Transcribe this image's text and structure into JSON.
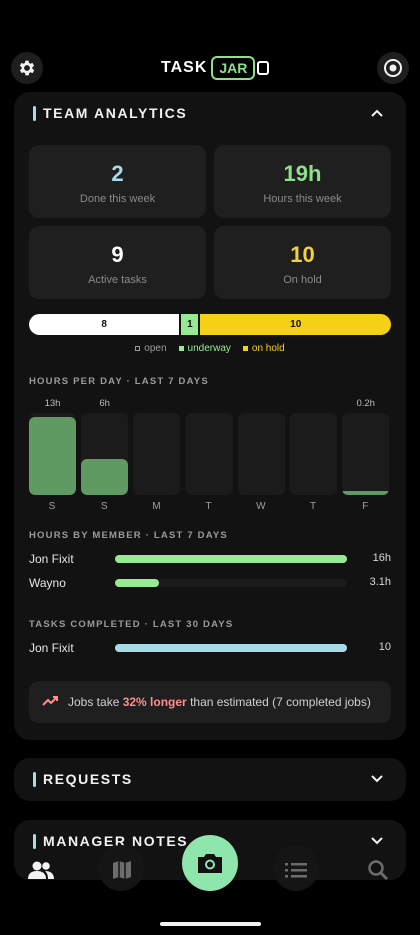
{
  "header": {
    "settings_icon": "gear-icon",
    "logo_left": "TASK",
    "logo_right": "JAR",
    "record_icon": "record-icon"
  },
  "analytics": {
    "title": "TEAM ANALYTICS",
    "stats": [
      {
        "value": "2",
        "label": "Done this week",
        "color": "#a8dbe6"
      },
      {
        "value": "19h",
        "label": "Hours this week",
        "color": "#8ee08a"
      },
      {
        "value": "9",
        "label": "Active tasks",
        "color": "#ffffff"
      },
      {
        "value": "10",
        "label": "On hold",
        "color": "#f4d03f"
      }
    ],
    "status_bar": [
      {
        "label": "8",
        "name": "open",
        "count": 8,
        "color": "#ffffff"
      },
      {
        "label": "1",
        "name": "underway",
        "count": 1,
        "color": "#97ea94"
      },
      {
        "label": "10",
        "name": "on hold",
        "count": 10,
        "color": "#f4d017"
      }
    ],
    "hours_per_day": {
      "label": "HOURS PER DAY · LAST 7 DAYS",
      "days": [
        "S",
        "S",
        "M",
        "T",
        "W",
        "T",
        "F"
      ],
      "value_labels": [
        "13h",
        "6h",
        "",
        "",
        "",
        "",
        "0.2h"
      ],
      "values": [
        13,
        6,
        0,
        0,
        0,
        0,
        0.2
      ],
      "max": 13
    },
    "hours_by_member": {
      "label": "HOURS BY MEMBER · LAST 7 DAYS",
      "rows": [
        {
          "name": "Jon Fixit",
          "value_label": "16h",
          "fraction": 1.0,
          "color": "#97ea94"
        },
        {
          "name": "Wayno",
          "value_label": "3.1h",
          "fraction": 0.19,
          "color": "#97ea94"
        }
      ]
    },
    "tasks_completed": {
      "label": "TASKS COMPLETED · LAST 30 DAYS",
      "rows": [
        {
          "name": "Jon Fixit",
          "value_label": "10",
          "fraction": 1.0,
          "color": "#a8dbe6"
        }
      ]
    },
    "insight": {
      "prefix": "Jobs take ",
      "highlight": "32% longer",
      "suffix": " than estimated (7 completed jobs)"
    }
  },
  "requests": {
    "title": "REQUESTS"
  },
  "notes": {
    "title": "MANAGER NOTES"
  },
  "nav": {
    "items": [
      "team-icon",
      "map-icon",
      "camera-icon",
      "list-icon",
      "search-icon"
    ]
  }
}
